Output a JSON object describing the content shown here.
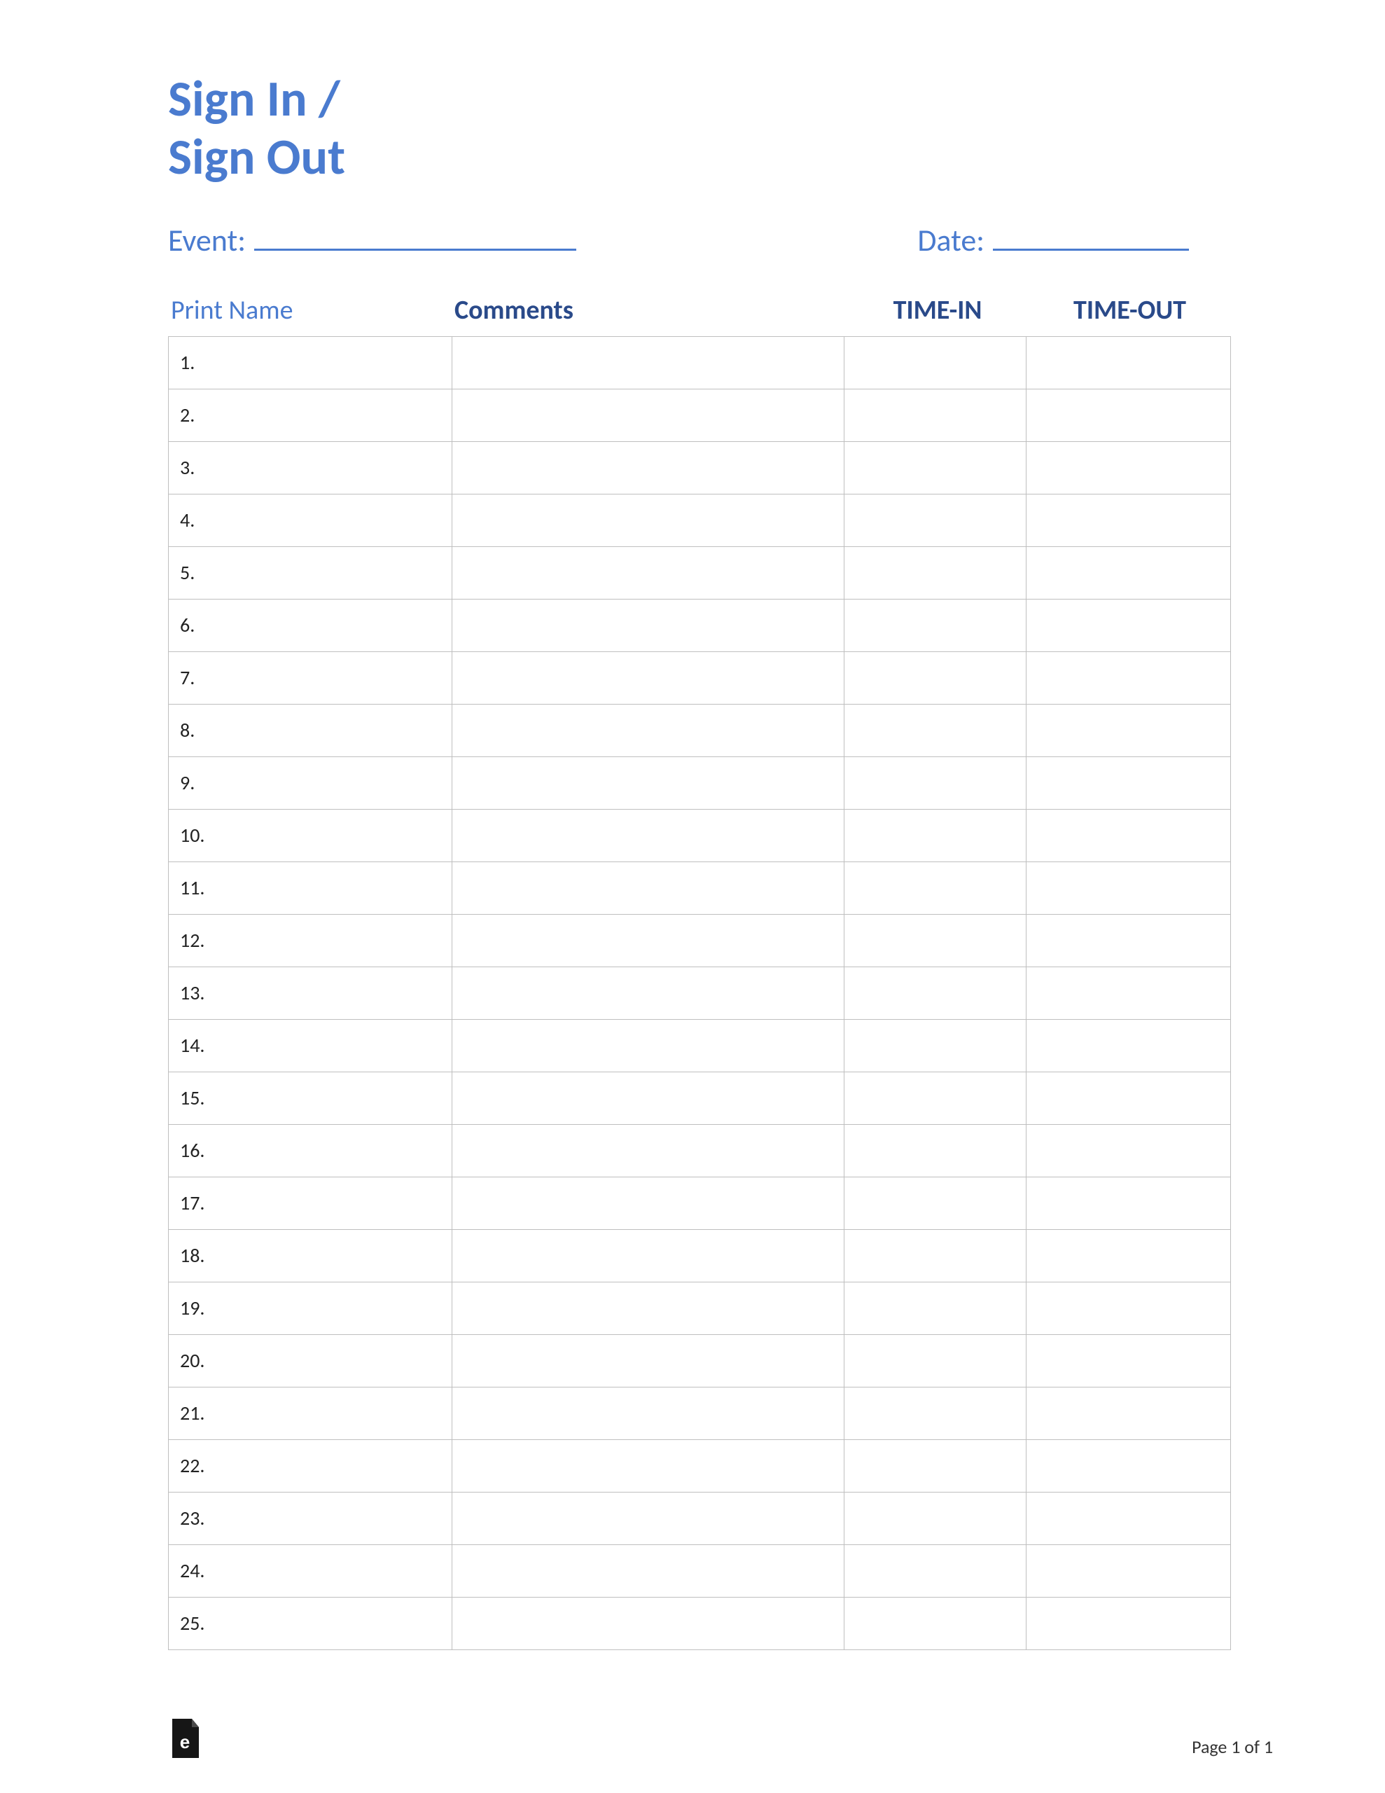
{
  "title_line1": "Sign In /",
  "title_line2": "Sign Out",
  "event_label": "Event:",
  "date_label": "Date:",
  "headers": {
    "name": "Print Name",
    "comments": "Comments",
    "timein": "TIME-IN",
    "timeout": "TIME-OUT"
  },
  "rows": [
    {
      "num": "1."
    },
    {
      "num": "2."
    },
    {
      "num": "3."
    },
    {
      "num": "4."
    },
    {
      "num": "5."
    },
    {
      "num": "6."
    },
    {
      "num": "7."
    },
    {
      "num": "8."
    },
    {
      "num": "9."
    },
    {
      "num": "10."
    },
    {
      "num": "11."
    },
    {
      "num": "12."
    },
    {
      "num": "13."
    },
    {
      "num": "14."
    },
    {
      "num": "15."
    },
    {
      "num": "16."
    },
    {
      "num": "17."
    },
    {
      "num": "18."
    },
    {
      "num": "19."
    },
    {
      "num": "20."
    },
    {
      "num": "21."
    },
    {
      "num": "22."
    },
    {
      "num": "23."
    },
    {
      "num": "24."
    },
    {
      "num": "25."
    }
  ],
  "footer_page": "Page 1 of 1"
}
